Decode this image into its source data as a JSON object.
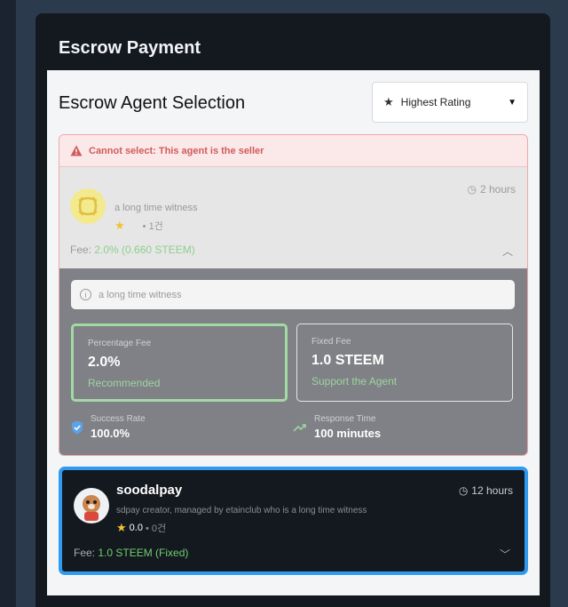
{
  "modal": {
    "title": "Escrow Payment"
  },
  "panel": {
    "title": "Escrow Agent Selection"
  },
  "sort": {
    "icon": "star-icon",
    "label": "Highest Rating"
  },
  "agents": [
    {
      "warning": "Cannot select: This agent is the seller",
      "time": "2 hours",
      "description": "a long time witness",
      "rating_count": "• 1건",
      "fee_label": "Fee: ",
      "fee_value": "2.0% (0.660 STEEM)",
      "info": "a long time witness",
      "percentage_fee": {
        "label": "Percentage Fee",
        "value": "2.0%",
        "note": "Recommended"
      },
      "fixed_fee": {
        "label": "Fixed Fee",
        "value": "1.0 STEEM",
        "note": "Support the Agent"
      },
      "success_rate": {
        "label": "Success Rate",
        "value": "100.0%"
      },
      "response_time": {
        "label": "Response Time",
        "value": "100 minutes"
      }
    },
    {
      "name": "soodalpay",
      "time": "12 hours",
      "description": "sdpay creator, managed by etainclub who is a long time witness",
      "rating": "0.0",
      "rating_count": "• 0건",
      "fee_label": "Fee: ",
      "fee_value": "1.0 STEEM (Fixed)"
    }
  ],
  "colors": {
    "accent": "#2f9bf0",
    "success": "#8dcf8d",
    "warning": "#d15a5a",
    "star": "#f2c232"
  }
}
